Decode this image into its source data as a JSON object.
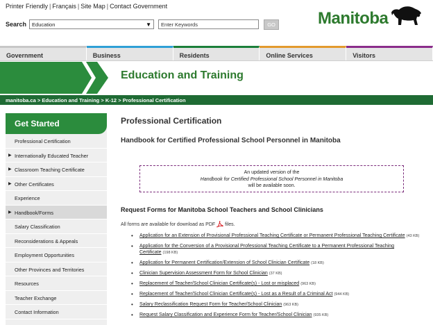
{
  "util": {
    "links": [
      "Printer Friendly",
      "Français",
      "Site Map",
      "Contact Government"
    ]
  },
  "search": {
    "label": "Search",
    "scope_value": "Education",
    "placeholder": "Enter Keywords",
    "go_label": "GO"
  },
  "logo": {
    "text": "Manitoba"
  },
  "mainnav": [
    "Government",
    "Business",
    "Residents",
    "Online Services",
    "Visitors"
  ],
  "banner": {
    "title": "Education and Training"
  },
  "breadcrumb": {
    "items": [
      "manitoba.ca",
      "Education and Training",
      "K-12",
      "Professional Certification"
    ],
    "sep": ">"
  },
  "sidebar": {
    "heading": "Get Started",
    "items": [
      {
        "label": "Professional Certification",
        "arrow": false,
        "active": false
      },
      {
        "label": "Internationally Educated Teacher",
        "arrow": true,
        "active": false
      },
      {
        "label": "Classroom Teaching Certificate",
        "arrow": true,
        "active": false
      },
      {
        "label": "Other Certificates",
        "arrow": true,
        "active": false
      },
      {
        "label": "Experience",
        "arrow": false,
        "active": false
      },
      {
        "label": "Handbook/Forms",
        "arrow": true,
        "active": true
      },
      {
        "label": "Salary Classification",
        "arrow": false,
        "active": false
      },
      {
        "label": "Reconsiderations & Appeals",
        "arrow": false,
        "active": false
      },
      {
        "label": "Employment Opportunities",
        "arrow": false,
        "active": false
      },
      {
        "label": "Other Provinces and Territories",
        "arrow": false,
        "active": false
      },
      {
        "label": "Resources",
        "arrow": false,
        "active": false
      },
      {
        "label": "Teacher Exchange",
        "arrow": false,
        "active": false
      },
      {
        "label": "Contact Information",
        "arrow": false,
        "active": false
      }
    ]
  },
  "main": {
    "title": "Professional Certification",
    "subtitle": "Handbook for Certified Professional School Personnel in Manitoba",
    "notice": {
      "line1": "An updated version of the",
      "line2": "Handbook for Certified Professional School Personnel in Manitoba",
      "line3": "will be available soon."
    },
    "section_heading": "Request Forms for Manitoba School Teachers and School Clinicians",
    "avail_before": "All forms are available for download as PDF",
    "avail_after": "files.",
    "forms": [
      {
        "text": "Application for an Extension of Provisional Professional Teaching Certificate or Permanent Professional Teaching Certificate",
        "size": "(43 KB)"
      },
      {
        "text": "Application for the Conversion of a Provisional Professional Teaching Certificate to a Permanent Professional Teaching Certificate",
        "size": "(198 KB)"
      },
      {
        "text": "Application for Permanent Certification/Extension of School Clinician Certificate",
        "size": "(18 KB)"
      },
      {
        "text": "Clinician Supervision Assessment Form for School Clinician",
        "size": "(37 KB)"
      },
      {
        "text": "Replacement of Teacher/School Clinician Certificate(s) - Lost or misplaced",
        "size": "(963 KB)"
      },
      {
        "text": "Replacement of Teacher/School Clinician Certificate(s) - Lost as a Result of a Criminal Act",
        "size": "(944 KB)"
      },
      {
        "text": "Salary Reclassification Request Form for Teacher/School Clinician",
        "size": "(963 KB)"
      },
      {
        "text": "Request Salary Classification and Experience Form for Teacher/School Clinician",
        "size": "(935 KB)"
      }
    ]
  },
  "colors": {
    "brand_green": "#2b8c3d",
    "dark_green": "#1f6b34",
    "notice_border": "#7a2a7a"
  }
}
